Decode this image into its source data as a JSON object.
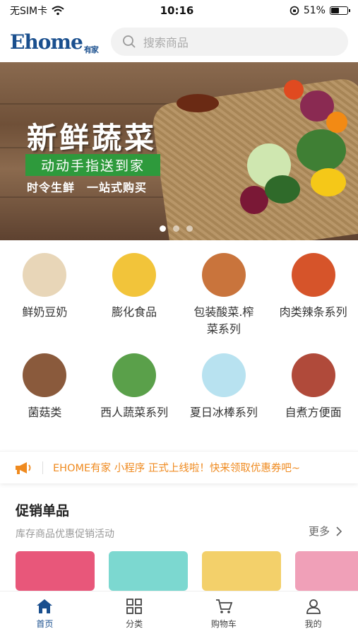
{
  "status": {
    "carrier": "无SIM卡",
    "time": "10:16",
    "battery": "51%",
    "battery_level": 0.51
  },
  "header": {
    "logo_text": "Ehome",
    "logo_sub": "有家",
    "search_placeholder": "搜索商品"
  },
  "banner": {
    "title": "新鲜蔬菜",
    "subtitle": "动动手指送到家",
    "tagline": "时令生鲜　一站式购买",
    "slide_count": 3,
    "active_slide": 0
  },
  "categories": [
    {
      "label": "鲜奶豆奶",
      "color": "#e8d6b8"
    },
    {
      "label": "膨化食品",
      "color": "#f2c43a"
    },
    {
      "label": "包装酸菜.榨菜系列",
      "color": "#c9743c"
    },
    {
      "label": "肉类辣条系列",
      "color": "#d6542a"
    },
    {
      "label": "菌菇类",
      "color": "#8a5a3c"
    },
    {
      "label": "西人蔬菜系列",
      "color": "#5aa04a"
    },
    {
      "label": "夏日冰棒系列",
      "color": "#b8e2f0"
    },
    {
      "label": "自煮方便面",
      "color": "#b04a3a"
    }
  ],
  "notice": {
    "text": "EHOME有家 小程序 正式上线啦！快来领取优惠券吧~"
  },
  "promo": {
    "title": "促销单品",
    "subtitle": "库存商品优惠促销活动",
    "more": "更多"
  },
  "products": [
    {
      "color": "#e8577a"
    },
    {
      "color": "#7cd8d0"
    },
    {
      "color": "#f3d06a"
    },
    {
      "color": "#f0a0b8"
    }
  ],
  "tabs": [
    {
      "label": "首页",
      "icon": "home-icon",
      "active": true
    },
    {
      "label": "分类",
      "icon": "grid-icon",
      "active": false
    },
    {
      "label": "购物车",
      "icon": "cart-icon",
      "active": false
    },
    {
      "label": "我的",
      "icon": "user-icon",
      "active": false
    }
  ],
  "colors": {
    "brand": "#1a4f8e",
    "notice": "#ef8a1f",
    "banner_green": "#2e9a3c"
  }
}
